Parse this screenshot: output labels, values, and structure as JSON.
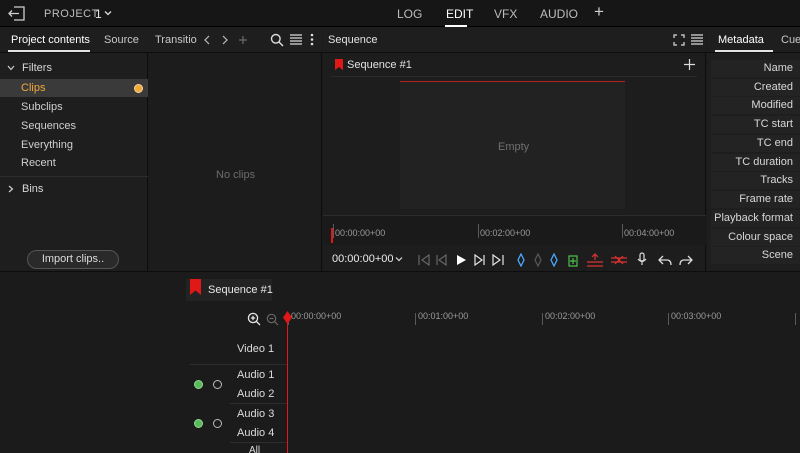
{
  "topbar": {
    "project_label": "PROJECT",
    "project_number": "1",
    "modes": [
      "LOG",
      "EDIT",
      "VFX",
      "AUDIO"
    ],
    "active_mode": "EDIT",
    "add_label": "+"
  },
  "left_panel": {
    "tabs": [
      "Project contents",
      "Source",
      "Transitio"
    ],
    "active_tab": "Project contents",
    "filters_heading": "Filters",
    "filters": [
      "Clips",
      "Subclips",
      "Sequences",
      "Everything",
      "Recent"
    ],
    "selected_filter": "Clips",
    "bins_heading": "Bins",
    "import_button": "Import clips.."
  },
  "clips_area": {
    "empty_text": "No clips"
  },
  "viewer": {
    "title": "Sequence",
    "sequence_name": "Sequence #1",
    "empty_text": "Empty",
    "ruler_labels": [
      "00:00:00+00",
      "00:02:00+00",
      "00:04:00+00"
    ],
    "timecode": "00:00:00+00"
  },
  "metadata_panel": {
    "tabs": [
      "Metadata",
      "Cue"
    ],
    "fields": [
      "Name",
      "Created",
      "Modified",
      "TC start",
      "TC end",
      "TC duration",
      "Tracks",
      "Frame rate",
      "Playback format",
      "Colour space",
      "Scene"
    ]
  },
  "timeline": {
    "sequence_tab": "Sequence #1",
    "ruler_labels": [
      "00:00:00+00",
      "00:01:00+00",
      "00:02:00+00",
      "00:03:00+00"
    ],
    "tracks": [
      "Video 1",
      "Audio 1",
      "Audio 2",
      "Audio 3",
      "Audio 4",
      "All"
    ]
  },
  "colors": {
    "accent": "#f0a93b",
    "playhead": "#e01818",
    "active_green": "#5cb85c"
  }
}
